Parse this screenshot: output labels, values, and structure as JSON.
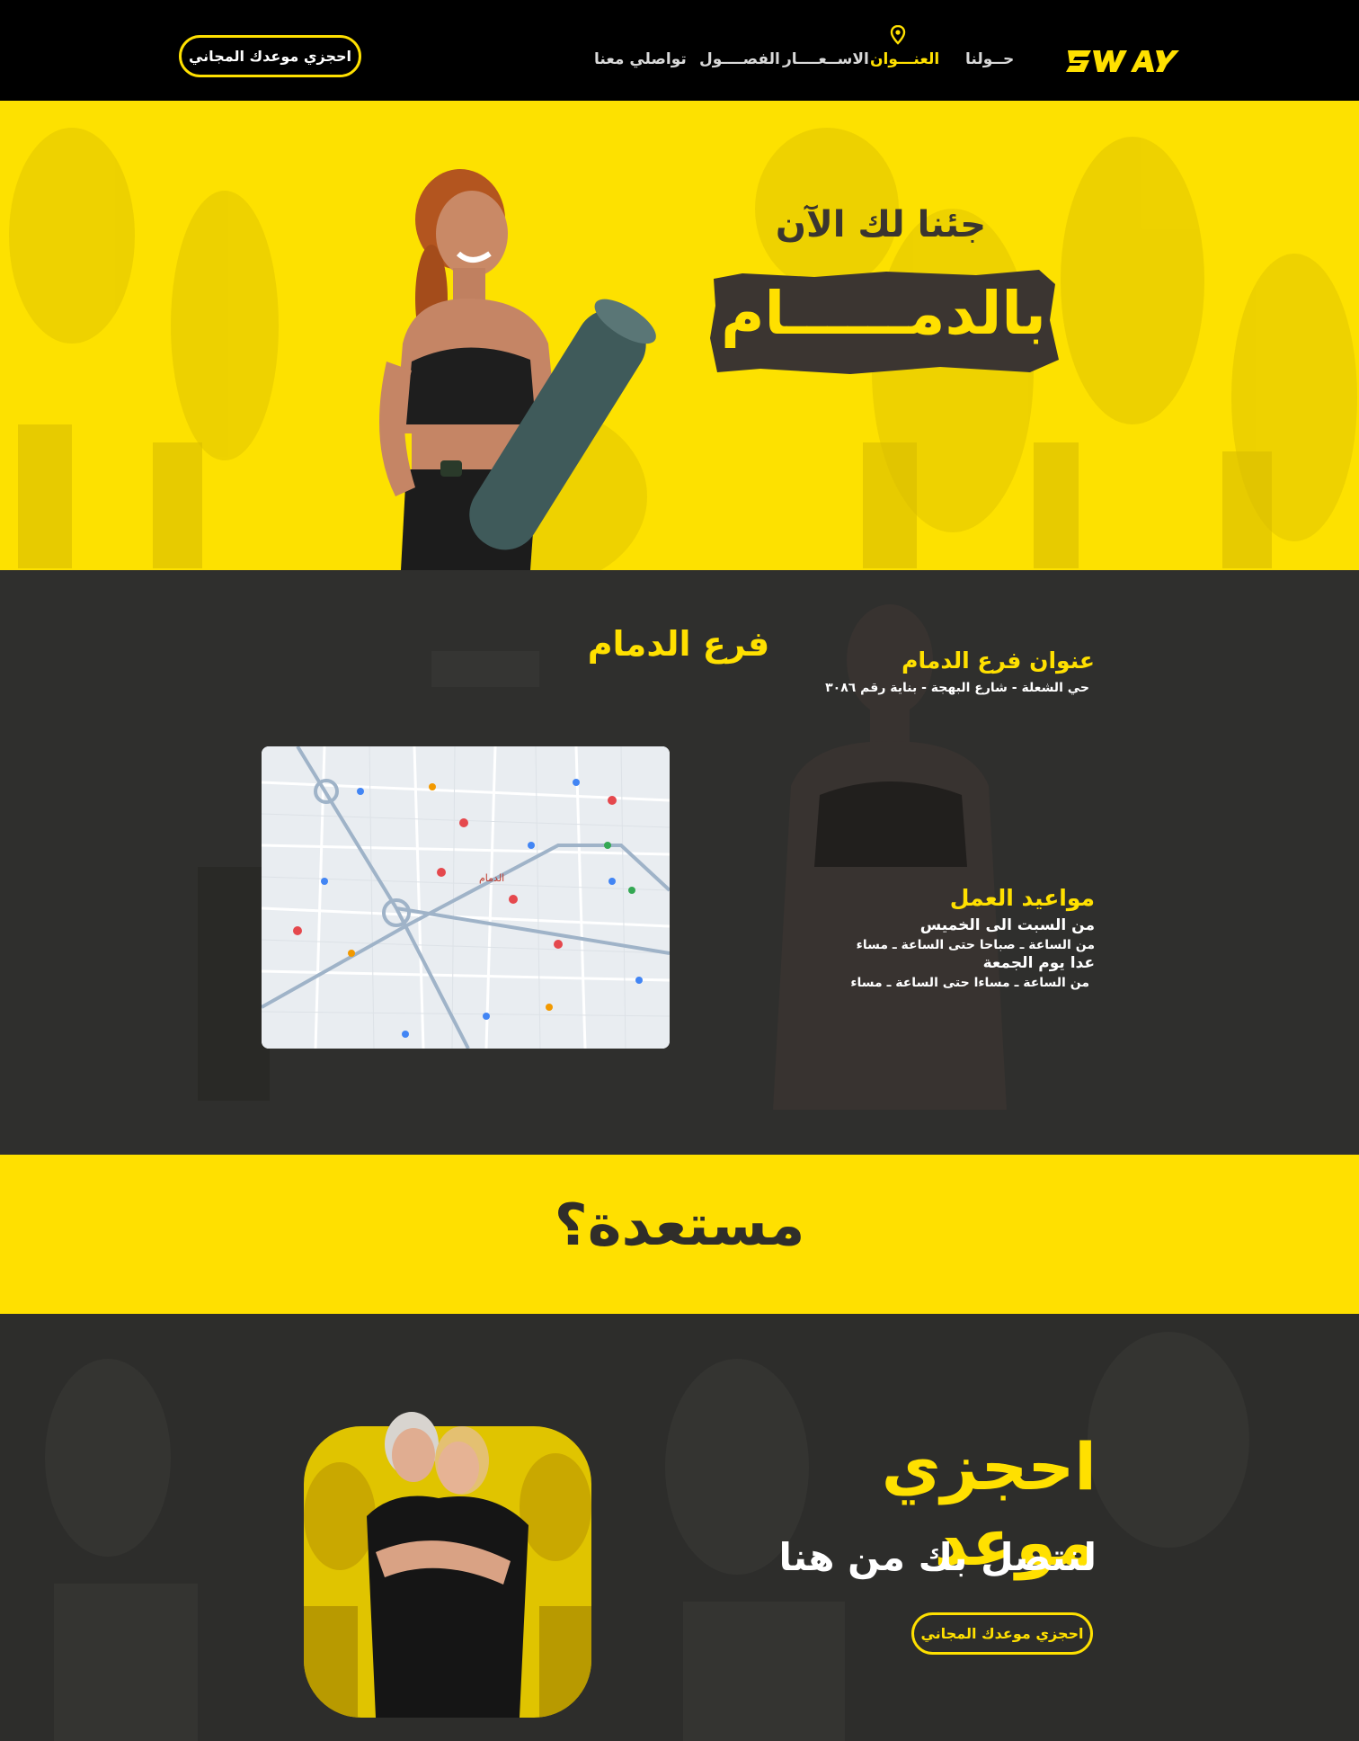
{
  "header": {
    "logo_text": "SWAY",
    "nav": [
      {
        "label": "حــولنا"
      },
      {
        "label": "العنـــوان"
      },
      {
        "label": "الاســعــــار"
      },
      {
        "label": "الفصــــول"
      },
      {
        "label": "تواصلي معنا"
      }
    ],
    "cta": "احجزي موعدك المجاني"
  },
  "hero": {
    "heading": "جئنا لك الآن",
    "city": "بالدمــــــام"
  },
  "branch": {
    "title": "فرع الدمام",
    "map_city_label": "الدمام",
    "address_heading": "عنوان فرع الدمام",
    "address_text": "حي الشعلة - شارع البهجة - بناية رقم ٣٠٨٦",
    "hours_heading": "مواعيد العمل",
    "weekdays_label": "من السبت الى الخميس",
    "weekdays_hours": "من الساعة ـ صباحا حتى الساعة ـ مساء",
    "except_label": "عدا يوم الجمعة",
    "friday_hours": "من الساعة ـ مساءا حتى الساعة ـ مساء"
  },
  "ready": {
    "text": "مستعدة؟"
  },
  "booking": {
    "title": "احجزي موعد",
    "subtitle": "لنتصل بك من هنا",
    "cta": "احجزي موعدك المجاني"
  },
  "colors": {
    "accent": "#ffe000",
    "dark": "#2f2f2d",
    "header_bg": "#000000"
  }
}
